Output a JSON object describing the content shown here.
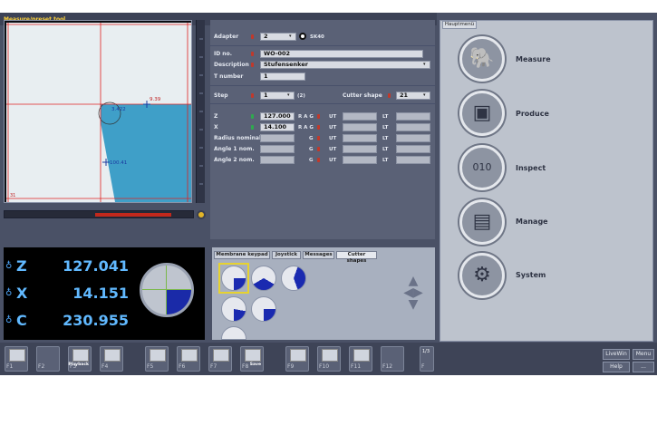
{
  "window": {
    "title": "Measure/preset tool"
  },
  "view": {
    "labels": {
      "angle": "3.422",
      "top": "9.39",
      "mid": "100.41",
      "corner": "31"
    }
  },
  "form": {
    "adapter": {
      "label": "Adapter",
      "value": "2",
      "note": "SK40"
    },
    "id": {
      "label": "ID no.",
      "value": "WO-002"
    },
    "description": {
      "label": "Description",
      "value": "Stufensenker"
    },
    "tnumber": {
      "label": "T number",
      "value": "1"
    },
    "step": {
      "label": "Step",
      "value": "1",
      "count": "(2)"
    },
    "cutter_shape": {
      "label": "Cutter shape",
      "value": "21"
    },
    "z": {
      "label": "Z",
      "value": "127.000",
      "flags": "R A G"
    },
    "x": {
      "label": "X",
      "value": "14.100",
      "flags": "R A G"
    },
    "radius": {
      "label": "Radius nominal",
      "flag": "G"
    },
    "angle1": {
      "label": "Angle 1 nom.",
      "flag": "G"
    },
    "angle2": {
      "label": "Angle 2 nom.",
      "flag": "G"
    },
    "ut": "UT",
    "lt": "LT"
  },
  "dro": {
    "axes": [
      {
        "axis": "Z",
        "value": "127.041"
      },
      {
        "axis": "X",
        "value": "14.151"
      },
      {
        "axis": "C",
        "value": "230.955"
      }
    ]
  },
  "shape_panel": {
    "tabs": [
      "Membrane keypad",
      "Joystick",
      "Messages",
      "Cutter shapes"
    ]
  },
  "main_menu": {
    "tab": "Hauptmenü",
    "items": [
      {
        "label": "Measure",
        "icon": "elephant-icon"
      },
      {
        "label": "Produce",
        "icon": "machine-icon"
      },
      {
        "label": "Inspect",
        "icon": "binary-inspect-icon"
      },
      {
        "label": "Manage",
        "icon": "folder-icon"
      },
      {
        "label": "System",
        "icon": "gears-icon"
      }
    ]
  },
  "fkeys": [
    {
      "key": "F1"
    },
    {
      "key": "F2"
    },
    {
      "key": "F3",
      "sub": "Playback"
    },
    {
      "key": "F4"
    },
    {
      "key": "F5"
    },
    {
      "key": "F6"
    },
    {
      "key": "F7"
    },
    {
      "key": "F8",
      "sub": "Save"
    },
    {
      "key": "F9"
    },
    {
      "key": "F10"
    },
    {
      "key": "F11"
    },
    {
      "key": "F12"
    }
  ],
  "pager": {
    "text": "1/3",
    "key": "F"
  },
  "right_buttons": {
    "livewin": "LiveWin",
    "menu": "Menu",
    "help": "Help",
    "more": "..."
  },
  "colors": {
    "accent": "#61b9ff",
    "workpiece": "#3f9fc8",
    "red_line": "#e02020",
    "bg": "#4a5166"
  }
}
